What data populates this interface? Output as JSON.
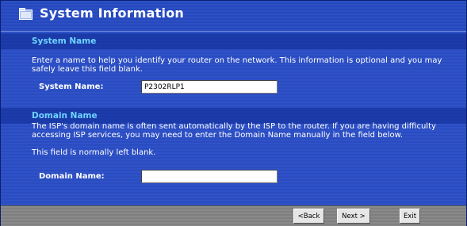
{
  "header": {
    "title": "System Information",
    "icon": "folder-icon"
  },
  "system_name_section": {
    "title": "System Name",
    "description": "Enter a name to help you identify your router on the network. This information is optional and you may safely leave this field blank.",
    "label": "System Name:",
    "value": "P2302RLP1"
  },
  "domain_name_section": {
    "title": "Domain Name",
    "description": "The ISP's domain name is often sent automatically by the ISP to the router. If you are having difficulty accessing ISP services, you may need to enter the Domain Name manually in the field below.",
    "note": "This field is normally left blank.",
    "label": "Domain Name:",
    "value": ""
  },
  "footer": {
    "back_label": "<Back",
    "next_label": "Next >",
    "exit_label": "Exit"
  },
  "colors": {
    "background": "#2f52c8",
    "section_title": "#6fd3ff",
    "footer": "#8a8a8a"
  }
}
